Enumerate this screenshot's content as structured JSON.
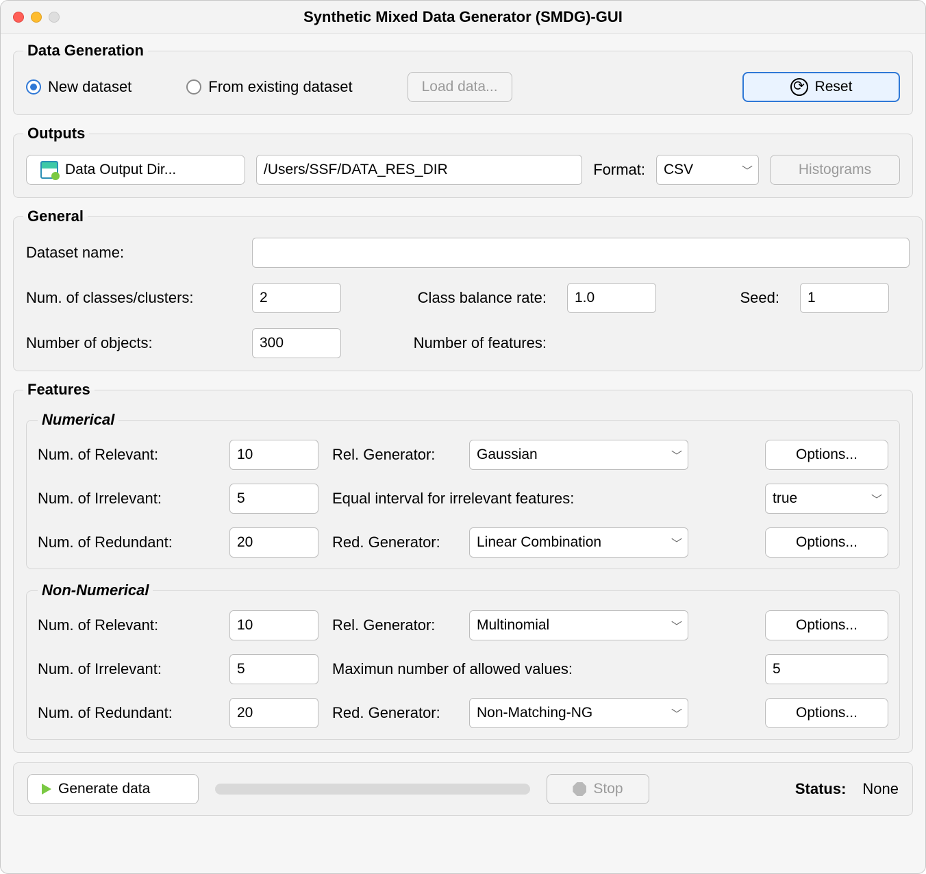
{
  "window_title": "Synthetic Mixed Data Generator (SMDG)-GUI",
  "data_generation": {
    "legend": "Data Generation",
    "new_dataset_label": "New dataset",
    "from_existing_label": "From existing dataset",
    "load_data_label": "Load data...",
    "reset_label": "Reset",
    "selection": "new"
  },
  "outputs": {
    "legend": "Outputs",
    "output_dir_button": "Data Output Dir...",
    "output_dir_value": "/Users/SSF/DATA_RES_DIR",
    "format_label": "Format:",
    "format_value": "CSV",
    "histograms_label": "Histograms"
  },
  "general": {
    "legend": "General",
    "dataset_name_label": "Dataset name:",
    "dataset_name_value": "",
    "num_classes_label": "Num. of classes/clusters:",
    "num_classes_value": "2",
    "class_balance_label": "Class balance rate:",
    "class_balance_value": "1.0",
    "seed_label": "Seed:",
    "seed_value": "1",
    "num_objects_label": "Number of objects:",
    "num_objects_value": "300",
    "num_features_label": "Number of features:",
    "num_features_value": ""
  },
  "features": {
    "legend": "Features",
    "numerical": {
      "legend": "Numerical",
      "num_relevant_label": "Num. of Relevant:",
      "num_relevant_value": "10",
      "rel_gen_label": "Rel. Generator:",
      "rel_gen_value": "Gaussian",
      "options_label": "Options...",
      "num_irrelevant_label": "Num. of Irrelevant:",
      "num_irrelevant_value": "5",
      "equal_interval_label": "Equal interval for irrelevant features:",
      "equal_interval_value": "true",
      "num_redundant_label": "Num. of Redundant:",
      "num_redundant_value": "20",
      "red_gen_label": "Red. Generator:",
      "red_gen_value": "Linear Combination"
    },
    "non_numerical": {
      "legend": "Non-Numerical",
      "num_relevant_label": "Num. of Relevant:",
      "num_relevant_value": "10",
      "rel_gen_label": "Rel. Generator:",
      "rel_gen_value": "Multinomial",
      "options_label": "Options...",
      "num_irrelevant_label": "Num. of Irrelevant:",
      "num_irrelevant_value": "5",
      "max_allowed_label": "Maximun number of allowed values:",
      "max_allowed_value": "5",
      "num_redundant_label": "Num. of Redundant:",
      "num_redundant_value": "20",
      "red_gen_label": "Red. Generator:",
      "red_gen_value": "Non-Matching-NG"
    }
  },
  "footer": {
    "generate_label": "Generate data",
    "stop_label": "Stop",
    "status_label": "Status:",
    "status_value": "None"
  }
}
